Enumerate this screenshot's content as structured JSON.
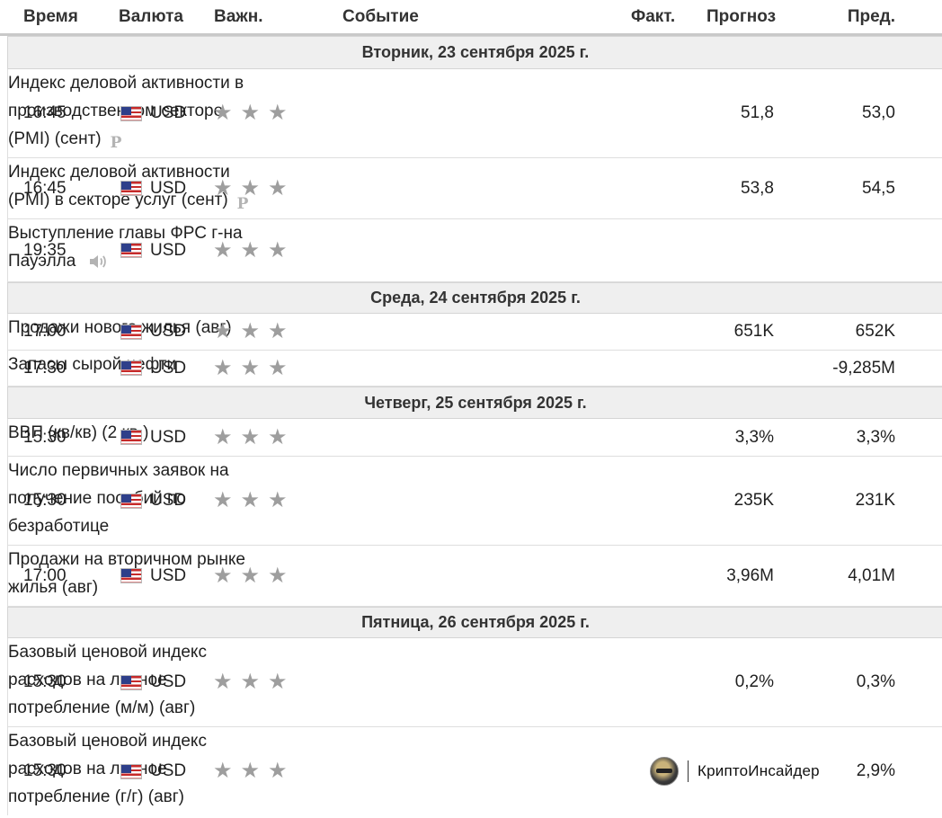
{
  "header": {
    "time": "Время",
    "currency": "Валюта",
    "importance": "Важн.",
    "event": "Событие",
    "actual": "Факт.",
    "forecast": "Прогноз",
    "previous": "Пред."
  },
  "days": [
    {
      "label": "Вторник, 23 сентября 2025 г."
    },
    {
      "label": "Среда, 24 сентября 2025 г."
    },
    {
      "label": "Четверг, 25 сентября 2025 г."
    },
    {
      "label": "Пятница, 26 сентября 2025 г."
    }
  ],
  "events": [
    {
      "time": "16:45",
      "currency": "USD",
      "stars": 3,
      "event_lines": [
        "Индекс деловой активности в",
        "производственном секторе",
        "(PMI) (сент)"
      ],
      "icon": "preliminary-icon",
      "actual": "",
      "forecast": "51,8",
      "previous": "53,0"
    },
    {
      "time": "16:45",
      "currency": "USD",
      "stars": 3,
      "event_lines": [
        "Индекс деловой активности",
        "(PMI) в секторе услуг (сент)"
      ],
      "icon": "preliminary-icon",
      "actual": "",
      "forecast": "53,8",
      "previous": "54,5"
    },
    {
      "time": "19:35",
      "currency": "USD",
      "stars": 3,
      "event_lines": [
        "Выступление главы ФРС г-на",
        "Пауэлла"
      ],
      "icon": "speaker-icon",
      "actual": "",
      "forecast": "",
      "previous": ""
    },
    {
      "time": "17:00",
      "currency": "USD",
      "stars": 3,
      "event_lines": [
        "Продажи нового жилья (авг)"
      ],
      "actual": "",
      "forecast": "651K",
      "previous": "652K"
    },
    {
      "time": "17:30",
      "currency": "USD",
      "stars": 3,
      "event_lines": [
        "Запасы сырой нефти"
      ],
      "actual": "",
      "forecast": "",
      "previous": "-9,285M"
    },
    {
      "time": "15:30",
      "currency": "USD",
      "stars": 3,
      "event_lines": [
        "ВВП (кв/кв) (2 кв.)"
      ],
      "actual": "",
      "forecast": "3,3%",
      "previous": "3,3%"
    },
    {
      "time": "15:30",
      "currency": "USD",
      "stars": 3,
      "event_lines": [
        "Число первичных заявок на",
        "получение пособий по",
        "безработице"
      ],
      "actual": "",
      "forecast": "235K",
      "previous": "231K"
    },
    {
      "time": "17:00",
      "currency": "USD",
      "stars": 3,
      "event_lines": [
        "Продажи на вторичном рынке",
        "жилья (авг)"
      ],
      "actual": "",
      "forecast": "3,96M",
      "previous": "4,01M"
    },
    {
      "time": "15:30",
      "currency": "USD",
      "stars": 3,
      "event_lines": [
        "Базовый ценовой индекс",
        "расходов на личное",
        "потребление (м/м) (авг)"
      ],
      "actual": "",
      "forecast": "0,2%",
      "previous": "0,3%"
    },
    {
      "time": "15:30",
      "currency": "USD",
      "stars": 3,
      "event_lines": [
        "Базовый ценовой индекс",
        "расходов на личное",
        "потребление (г/г) (авг)"
      ],
      "actual": "",
      "forecast": "",
      "previous": "2,9%"
    }
  ],
  "watermark": {
    "text": "КриптоИнсайдер"
  },
  "colors": {
    "day_bg": "#efefef",
    "star": "#9e9e9e",
    "icon_gray": "#b3b3b3"
  }
}
